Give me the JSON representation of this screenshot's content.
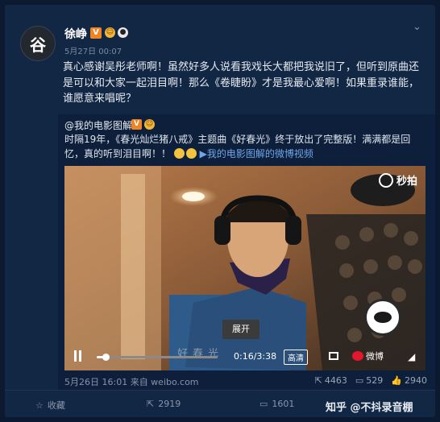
{
  "post": {
    "username": "徐峥",
    "v_badge": "V",
    "avatar_char": "谷",
    "time": "5月27日 00:07",
    "content": "真心感谢吴彤老师啊！虽然好多人说看我戏长大都把我说旧了，但听到原曲还是可以和大家一起泪目啊！那么《卷睫盼》才是我最心爱啊！如果重录谁能，谁愿意来唱呢？",
    "chevron": "⌄"
  },
  "repost": {
    "user": "@我的电影图解",
    "v_badge": "V",
    "text_prefix": "时隔19年，《春光灿烂猪八戒》主题曲《好春光》终于放出了完整版！满满都是回忆，真的听到泪目啊！！",
    "link": "我的电影图解的微博视频",
    "footer_time": "5月26日 16:01 来自 weibo.com",
    "stats": {
      "share": "4463",
      "comment": "529",
      "like": "2940"
    }
  },
  "video": {
    "brand": "秒拍",
    "time": "0:16/3:38",
    "quality": "高清",
    "platform": "微博",
    "expand_tooltip": "展开",
    "subtitle": "好春光",
    "progress": 0.07
  },
  "actions": {
    "collect": "收藏",
    "share": "2919",
    "comment": "1601"
  },
  "watermark": "知乎 @不抖录音棚"
}
